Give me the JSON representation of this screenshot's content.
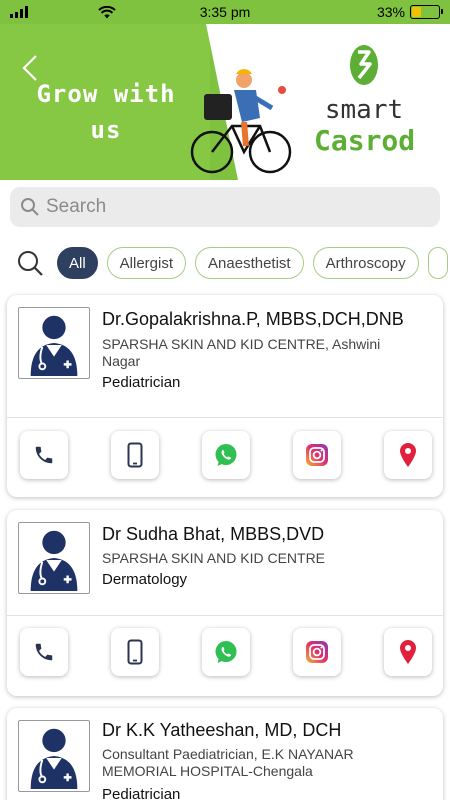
{
  "status_bar": {
    "time": "3:35 pm",
    "battery_percent": "33%",
    "battery_level": 0.33
  },
  "banner": {
    "title": "Grow with us",
    "brand_line1": "smart",
    "brand_line2": "Casrod",
    "colors": {
      "green": "#7ec23f",
      "brand_green": "#5cae35"
    }
  },
  "search": {
    "placeholder": "Search"
  },
  "filters": {
    "chips": [
      "All",
      "Allergist",
      "Anaesthetist",
      "Arthroscopy"
    ],
    "active": "All"
  },
  "doctors": [
    {
      "name": "Dr.Gopalakrishna.P, MBBS,DCH,DNB",
      "org": "SPARSHA SKIN AND KID CENTRE, Ashwini Nagar",
      "specialty": "Pediatrician"
    },
    {
      "name": "Dr Sudha Bhat, MBBS,DVD",
      "org": "SPARSHA SKIN AND KID CENTRE",
      "specialty": "Dermatology"
    },
    {
      "name": "Dr K.K Yatheeshan, MD, DCH",
      "org": "Consultant Paediatrician, E.K NAYANAR MEMORIAL HOSPITAL-Chengala",
      "specialty": "Pediatrician"
    }
  ],
  "actions": [
    "phone-icon",
    "mobile-icon",
    "whatsapp-icon",
    "instagram-icon",
    "location-pin-icon"
  ]
}
